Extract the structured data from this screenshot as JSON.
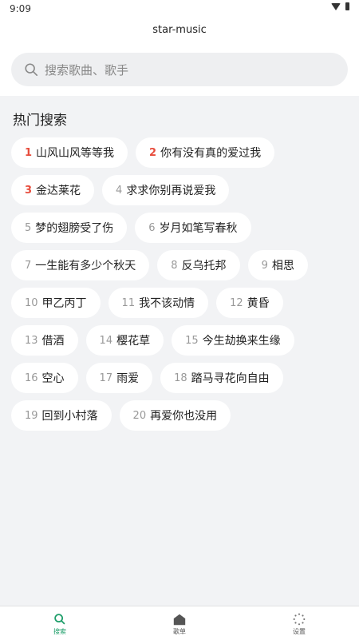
{
  "status": {
    "time": "9:09"
  },
  "app": {
    "title": "star-music"
  },
  "search": {
    "placeholder": "搜索歌曲、歌手"
  },
  "hot": {
    "title": "热门搜索",
    "items": [
      {
        "rank": "1",
        "label": "山风山风等等我"
      },
      {
        "rank": "2",
        "label": "你有没有真的爱过我"
      },
      {
        "rank": "3",
        "label": "金达莱花"
      },
      {
        "rank": "4",
        "label": "求求你别再说爱我"
      },
      {
        "rank": "5",
        "label": "梦的翅膀受了伤"
      },
      {
        "rank": "6",
        "label": "岁月如笔写春秋"
      },
      {
        "rank": "7",
        "label": "一生能有多少个秋天"
      },
      {
        "rank": "8",
        "label": "反乌托邦"
      },
      {
        "rank": "9",
        "label": "相思"
      },
      {
        "rank": "10",
        "label": "甲乙丙丁"
      },
      {
        "rank": "11",
        "label": "我不该动情"
      },
      {
        "rank": "12",
        "label": "黄昏"
      },
      {
        "rank": "13",
        "label": "借酒"
      },
      {
        "rank": "14",
        "label": "樱花草"
      },
      {
        "rank": "15",
        "label": "今生劫换来生缘"
      },
      {
        "rank": "16",
        "label": "空心"
      },
      {
        "rank": "17",
        "label": "雨爱"
      },
      {
        "rank": "18",
        "label": "踏马寻花向自由"
      },
      {
        "rank": "19",
        "label": "回到小村落"
      },
      {
        "rank": "20",
        "label": "再爱你也没用"
      }
    ]
  },
  "nav": {
    "search_label": "搜索",
    "playlist_label": "歌单",
    "settings_label": "设置"
  },
  "colors": {
    "accent": "#1e9e6a",
    "hot_rank": "#e74c3c"
  }
}
